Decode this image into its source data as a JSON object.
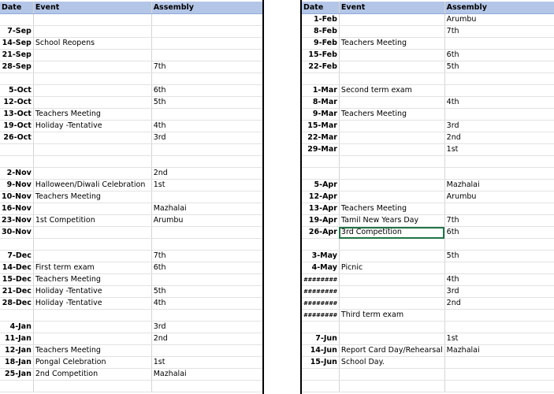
{
  "headers": {
    "date": "Date",
    "event": "Event",
    "assembly": "Assembly"
  },
  "left_rows": [
    [
      "",
      "",
      ""
    ],
    [
      "7-Sep",
      "",
      ""
    ],
    [
      "14-Sep",
      "School Reopens",
      ""
    ],
    [
      "21-Sep",
      "",
      ""
    ],
    [
      "28-Sep",
      "",
      "7th"
    ],
    [
      "",
      "",
      ""
    ],
    [
      "5-Oct",
      "",
      "6th"
    ],
    [
      "12-Oct",
      "",
      "5th"
    ],
    [
      "13-Oct",
      "Teachers Meeting",
      ""
    ],
    [
      "19-Oct",
      "Holiday -Tentative",
      "4th"
    ],
    [
      "26-Oct",
      "",
      "3rd"
    ],
    [
      "",
      "",
      ""
    ],
    [
      "",
      "",
      ""
    ],
    [
      "2-Nov",
      "",
      "2nd"
    ],
    [
      "9-Nov",
      "Halloween/Diwali Celebration",
      "1st"
    ],
    [
      "10-Nov",
      "Teachers Meeting",
      ""
    ],
    [
      "16-Nov",
      "",
      "Mazhalai"
    ],
    [
      "23-Nov",
      "1st Competition",
      "Arumbu"
    ],
    [
      "30-Nov",
      "",
      ""
    ],
    [
      "",
      "",
      ""
    ],
    [
      "7-Dec",
      "",
      "7th"
    ],
    [
      "14-Dec",
      "First term exam",
      "6th"
    ],
    [
      "15-Dec",
      "Teachers Meeting",
      ""
    ],
    [
      "21-Dec",
      "Holiday -Tentative",
      "5th"
    ],
    [
      "28-Dec",
      "Holiday -Tentative",
      "4th"
    ],
    [
      "",
      "",
      ""
    ],
    [
      "4-Jan",
      "",
      "3rd"
    ],
    [
      "11-Jan",
      "",
      "2nd"
    ],
    [
      "12-Jan",
      "Teachers Meeting",
      ""
    ],
    [
      "18-Jan",
      "Pongal Celebration",
      "1st"
    ],
    [
      "25-Jan",
      "2nd Competition",
      "Mazhalai"
    ],
    [
      "",
      "",
      ""
    ]
  ],
  "right_rows": [
    [
      "1-Feb",
      "",
      "Arumbu"
    ],
    [
      "8-Feb",
      "",
      "7th"
    ],
    [
      "9-Feb",
      "Teachers Meeting",
      ""
    ],
    [
      "15-Feb",
      "",
      "6th"
    ],
    [
      "22-Feb",
      "",
      "5th"
    ],
    [
      "",
      "",
      ""
    ],
    [
      "1-Mar",
      "Second term exam",
      ""
    ],
    [
      "8-Mar",
      "",
      "4th"
    ],
    [
      "9-Mar",
      "Teachers Meeting",
      ""
    ],
    [
      "15-Mar",
      "",
      "3rd"
    ],
    [
      "22-Mar",
      "",
      "2nd"
    ],
    [
      "29-Mar",
      "",
      "1st"
    ],
    [
      "",
      "",
      ""
    ],
    [
      "",
      "",
      ""
    ],
    [
      "5-Apr",
      "",
      "Mazhalai"
    ],
    [
      "12-Apr",
      "",
      "Arumbu"
    ],
    [
      "13-Apr",
      "Teachers Meeting",
      ""
    ],
    [
      "19-Apr",
      "Tamil New Years Day",
      "7th"
    ],
    [
      "26-Apr",
      "3rd Competition",
      "6th"
    ],
    [
      "",
      "",
      ""
    ],
    [
      "3-May",
      "",
      "5th"
    ],
    [
      "4-May",
      "Picnic",
      ""
    ],
    [
      "########",
      "",
      "4th"
    ],
    [
      "########",
      "",
      "3rd"
    ],
    [
      "########",
      "",
      "2nd"
    ],
    [
      "########",
      "Third term exam",
      ""
    ],
    [
      "",
      "",
      ""
    ],
    [
      "7-Jun",
      "",
      "1st"
    ],
    [
      "14-Jun",
      "Report Card Day/Rehearsal",
      "Mazhalai"
    ],
    [
      "15-Jun",
      "School Day.",
      ""
    ],
    [
      "",
      "",
      ""
    ],
    [
      "",
      "",
      ""
    ]
  ]
}
